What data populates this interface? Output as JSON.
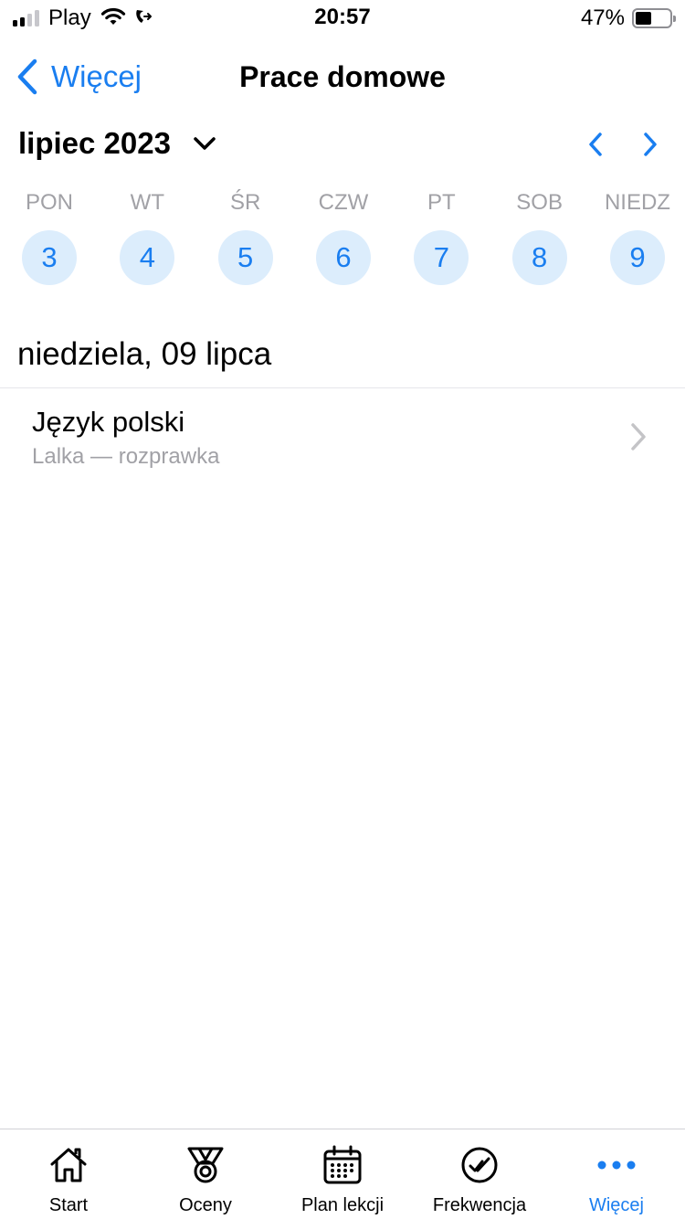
{
  "status_bar": {
    "carrier": "Play",
    "time": "20:57",
    "battery_pct": "47%",
    "battery_level": 0.47
  },
  "nav": {
    "back_label": "Więcej",
    "title": "Prace domowe"
  },
  "calendar": {
    "month_label": "lipiec 2023",
    "days": [
      {
        "name": "PON",
        "num": "3"
      },
      {
        "name": "WT",
        "num": "4"
      },
      {
        "name": "ŚR",
        "num": "5"
      },
      {
        "name": "CZW",
        "num": "6"
      },
      {
        "name": "PT",
        "num": "7"
      },
      {
        "name": "SOB",
        "num": "8"
      },
      {
        "name": "NIEDZ",
        "num": "9"
      }
    ]
  },
  "selected_date_label": "niedziela, 09 lipca",
  "homework": [
    {
      "subject": "Język polski",
      "description": "Lalka — rozprawka"
    }
  ],
  "tabs": [
    {
      "label": "Start",
      "icon": "home-icon"
    },
    {
      "label": "Oceny",
      "icon": "medal-icon"
    },
    {
      "label": "Plan lekcji",
      "icon": "calendar-icon"
    },
    {
      "label": "Frekwencja",
      "icon": "check-circle-icon"
    },
    {
      "label": "Więcej",
      "icon": "more-icon",
      "active": true
    }
  ],
  "colors": {
    "accent": "#1a7ef0",
    "day_circle_bg": "#dcedfc",
    "muted_text": "#a1a1a6"
  }
}
